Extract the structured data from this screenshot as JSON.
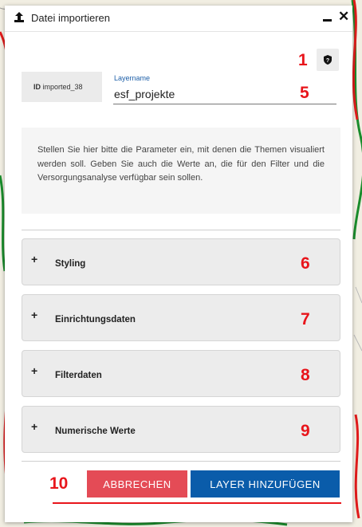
{
  "dialog": {
    "title": "Datei importieren",
    "id_prefix": "ID",
    "id_value": "imported_38",
    "layername_label": "Layername",
    "layername_value": "esf_projekte",
    "description": "Stellen Sie hier bitte die Parameter ein, mit denen die Themen visualiert werden soll. Geben Sie auch die Werte an, die für den Filter und die Versorgungsanalyse verfügbar sein sollen.",
    "sections": [
      {
        "label": "Styling",
        "marker": "6"
      },
      {
        "label": "Einrichtungsdaten",
        "marker": "7"
      },
      {
        "label": "Filterdaten",
        "marker": "8"
      },
      {
        "label": "Numerische Werte",
        "marker": "9"
      }
    ],
    "cancel_label": "ABBRECHEN",
    "add_label": "LAYER HINZUFÜGEN",
    "expand_glyph": "+"
  },
  "annotations": {
    "info": "1",
    "layername": "5",
    "buttons": "10"
  },
  "icons": {
    "upload": "upload-icon",
    "minimize": "minimize-icon",
    "close": "close-icon",
    "info": "info-icon"
  },
  "colors": {
    "cancel": "#e44b56",
    "add": "#0a5caa",
    "annotation": "#e8151b",
    "label_link": "#1d5fa8"
  }
}
